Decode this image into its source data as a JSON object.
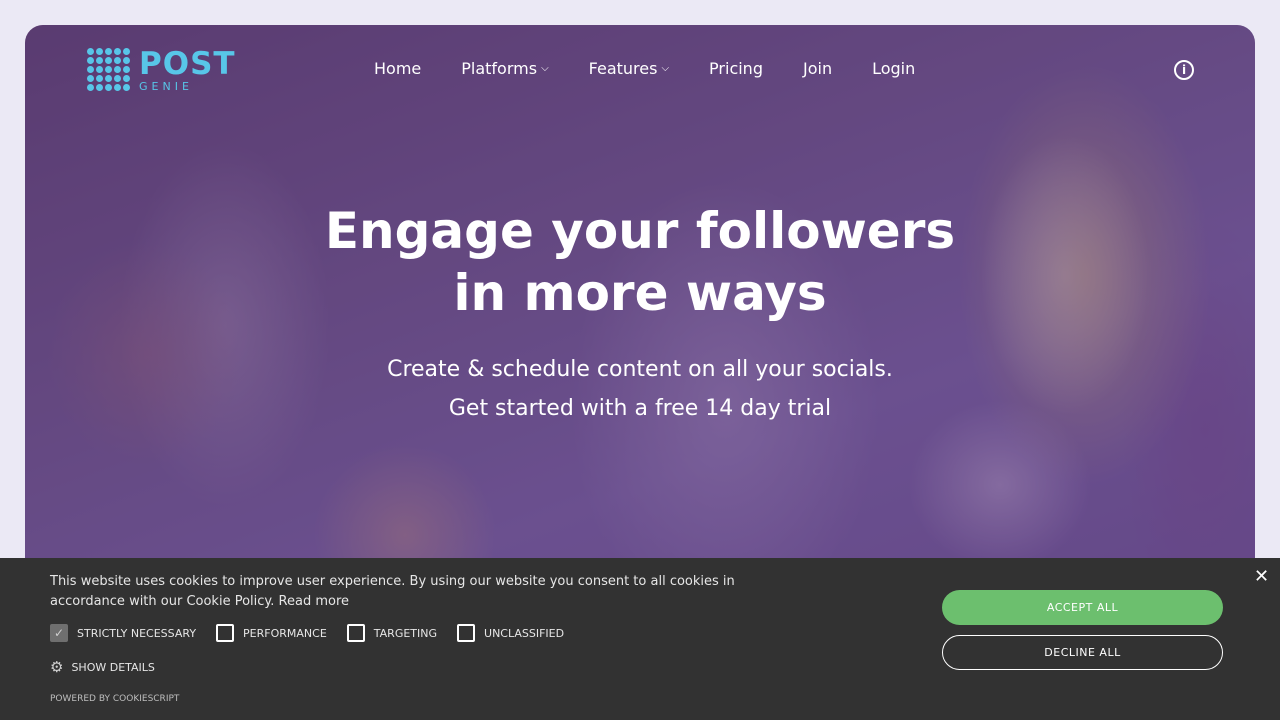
{
  "header": {
    "logo": {
      "main": "POST",
      "sub": "GENIE"
    },
    "nav": [
      {
        "label": "Home",
        "has_dropdown": false
      },
      {
        "label": "Platforms",
        "has_dropdown": true
      },
      {
        "label": "Features",
        "has_dropdown": true
      },
      {
        "label": "Pricing",
        "has_dropdown": false
      },
      {
        "label": "Join",
        "has_dropdown": false
      },
      {
        "label": "Login",
        "has_dropdown": false
      }
    ],
    "info_icon": "info-icon"
  },
  "hero": {
    "headline_line1": "Engage your followers",
    "headline_line2": "in more ways",
    "sub_line1": "Create & schedule content on all your socials.",
    "sub_line2": "Get started with a free 14 day trial"
  },
  "cookie_banner": {
    "text": "This website uses cookies to improve user experience. By using our website you consent to all cookies in accordance with our Cookie Policy.",
    "read_more": "Read more",
    "checkboxes": [
      {
        "label": "Strictly necessary",
        "checked": true
      },
      {
        "label": "Performance",
        "checked": false
      },
      {
        "label": "Targeting",
        "checked": false
      },
      {
        "label": "Unclassified",
        "checked": false
      }
    ],
    "show_details": "Show details",
    "powered_by": "Powered by CookieScript",
    "accept_label": "Accept all",
    "decline_label": "Decline all",
    "close_icon": "close-icon"
  },
  "colors": {
    "brand": "#58c6e8",
    "accept": "#6cbf6e",
    "banner_bg": "#323232",
    "page_bg": "#ebe9f5"
  }
}
